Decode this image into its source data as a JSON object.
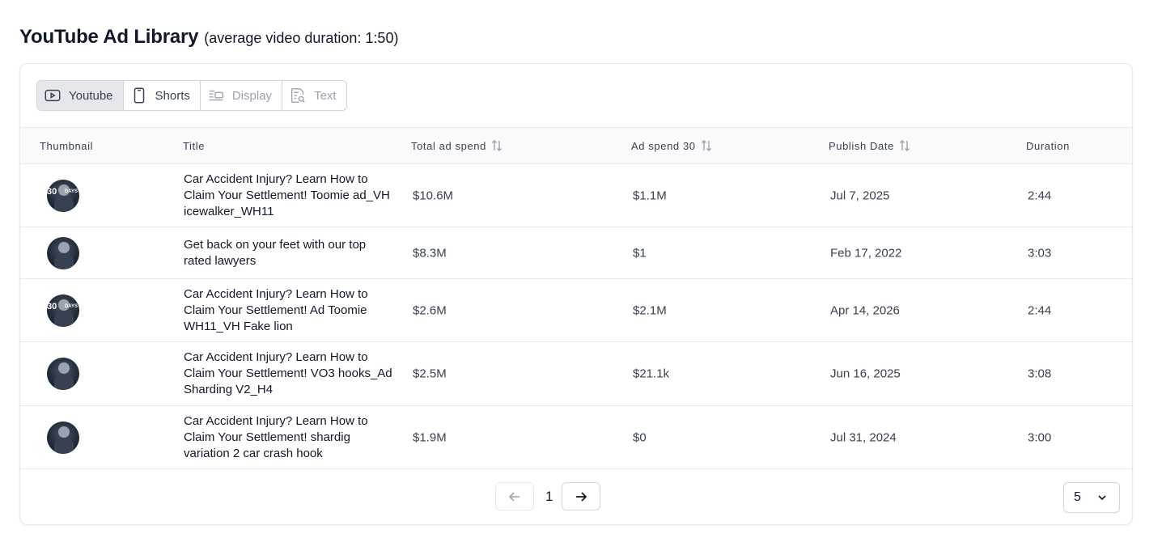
{
  "header": {
    "title": "YouTube Ad Library",
    "subtitle": "(average video duration: 1:50)"
  },
  "tabs": [
    {
      "label": "Youtube",
      "icon": "play-video-icon",
      "active": true
    },
    {
      "label": "Shorts",
      "icon": "phone-icon",
      "active": false
    },
    {
      "label": "Display",
      "icon": "display-layout-icon",
      "active": false
    },
    {
      "label": "Text",
      "icon": "text-search-icon",
      "active": false
    }
  ],
  "table": {
    "columns": {
      "thumbnail": "Thumbnail",
      "title": "Title",
      "total_spend": "Total ad spend",
      "spend_30": "Ad spend 30",
      "publish_date": "Publish Date",
      "duration": "Duration"
    },
    "rows": [
      {
        "thumb_text": "30",
        "thumb_tag": "DAYS",
        "title": "Car Accident Injury? Learn How to Claim Your Settlement! Toomie ad_VH icewalker_WH11",
        "total_spend": "$10.6M",
        "spend_30": "$1.1M",
        "publish_date": "Jul 7, 2025",
        "duration": "2:44"
      },
      {
        "thumb_text": "",
        "thumb_tag": "",
        "title": "Get back on your feet with our top rated lawyers",
        "total_spend": "$8.3M",
        "spend_30": "$1",
        "publish_date": "Feb 17, 2022",
        "duration": "3:03"
      },
      {
        "thumb_text": "30",
        "thumb_tag": "DAYS",
        "title": "Car Accident Injury? Learn How to Claim Your Settlement! Ad Toomie WH11_VH Fake lion",
        "total_spend": "$2.6M",
        "spend_30": "$2.1M",
        "publish_date": "Apr 14, 2026",
        "duration": "2:44"
      },
      {
        "thumb_text": "",
        "thumb_tag": "",
        "title": "Car Accident Injury? Learn How to Claim Your Settlement! VO3 hooks_Ad Sharding V2_H4",
        "total_spend": "$2.5M",
        "spend_30": "$21.1k",
        "publish_date": "Jun 16, 2025",
        "duration": "3:08"
      },
      {
        "thumb_text": "",
        "thumb_tag": "",
        "title": "Car Accident Injury? Learn How to Claim Your Settlement! shardig variation 2 car crash hook",
        "total_spend": "$1.9M",
        "spend_30": "$0",
        "publish_date": "Jul 31, 2024",
        "duration": "3:00"
      }
    ]
  },
  "pagination": {
    "current_page": "1",
    "page_size": "5"
  },
  "colors": {
    "active_tab_bg": "#e5e7eb",
    "border": "#d1d5db",
    "muted_text": "#9ca3af"
  }
}
